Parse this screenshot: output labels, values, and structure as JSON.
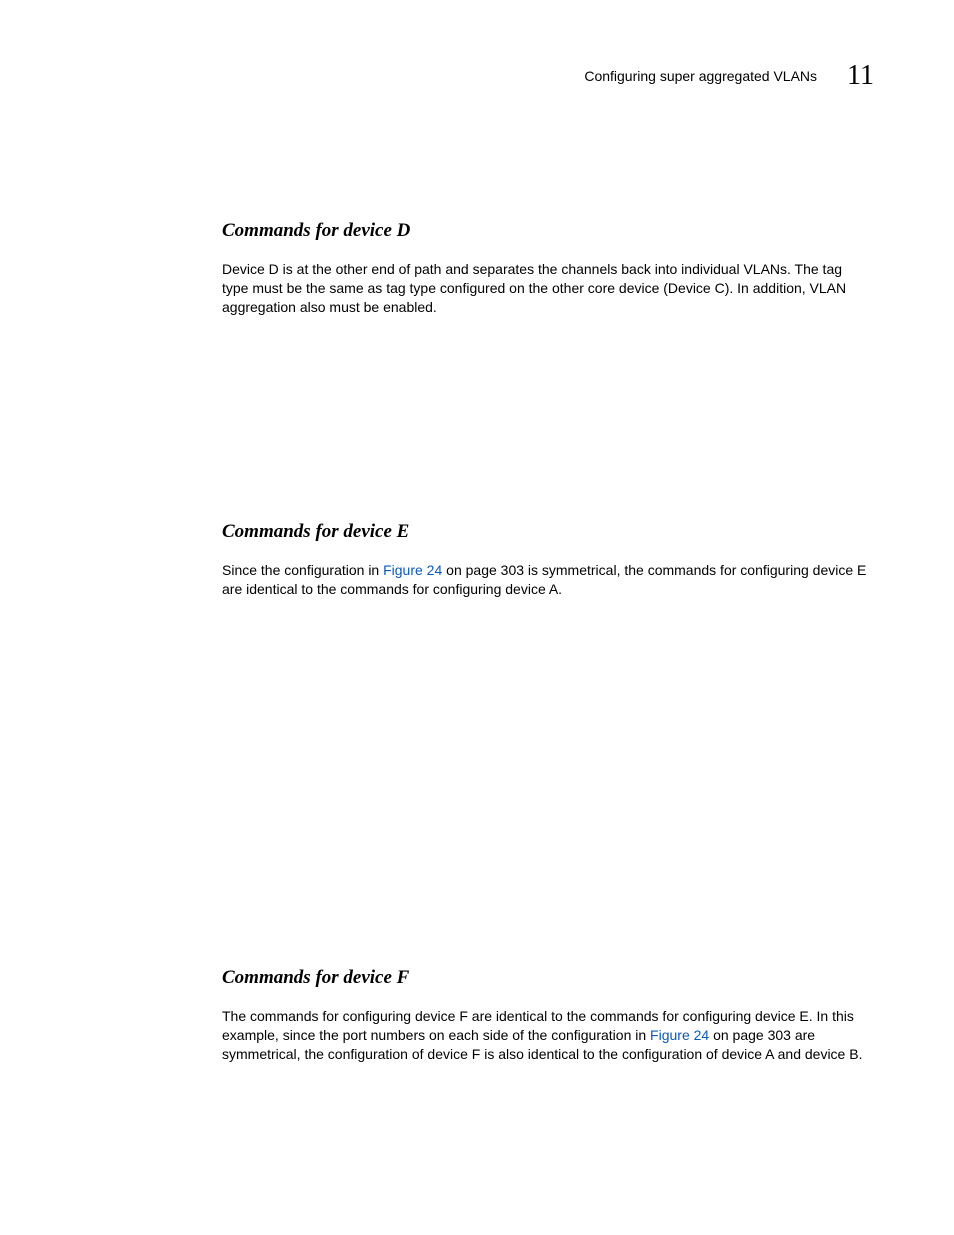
{
  "header": {
    "title": "Configuring super aggregated VLANs",
    "chapter": "11"
  },
  "sections": [
    {
      "heading": "Commands for device D",
      "paragraph_pre": "Device D is at the other end of path and separates the channels back into individual VLANs.  The tag type must be the same as tag type configured on the other core device (Device C).  In addition, VLAN aggregation also must be enabled."
    },
    {
      "heading": "Commands for device E",
      "paragraph_pre": "Since the configuration in ",
      "link_text": "Figure 24",
      "paragraph_post": " on page 303 is symmetrical, the commands for configuring device E are identical to the commands for configuring device A."
    },
    {
      "heading": "Commands for device F",
      "paragraph_pre": "The commands for configuring device F are identical to the commands for configuring device E. In this example, since the port numbers on each side of the configuration in ",
      "link_text": "Figure 24",
      "paragraph_post": " on page 303 are symmetrical, the configuration of device F is also identical to the configuration of device A and device B."
    }
  ]
}
